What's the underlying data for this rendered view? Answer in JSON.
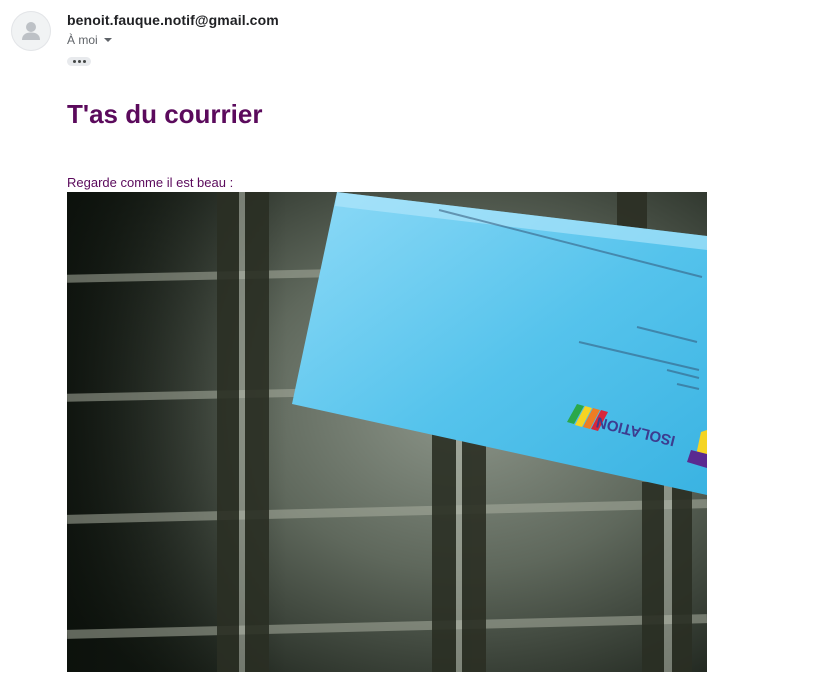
{
  "email": {
    "sender": "benoit.fauque.notif@gmail.com",
    "recipient_label": "À moi",
    "title": "T'as du courrier",
    "intro": "Regarde comme il est beau :"
  },
  "icons": {
    "avatar": "person-icon",
    "recipient_dropdown": "caret-down-icon",
    "more": "ellipsis-icon"
  },
  "photo": {
    "envelope_text": "ISOLATION"
  },
  "colors": {
    "title": "#5b0a5c",
    "sender": "#202124",
    "secondary": "#5f6368",
    "envelope": "#5cc6ef"
  }
}
